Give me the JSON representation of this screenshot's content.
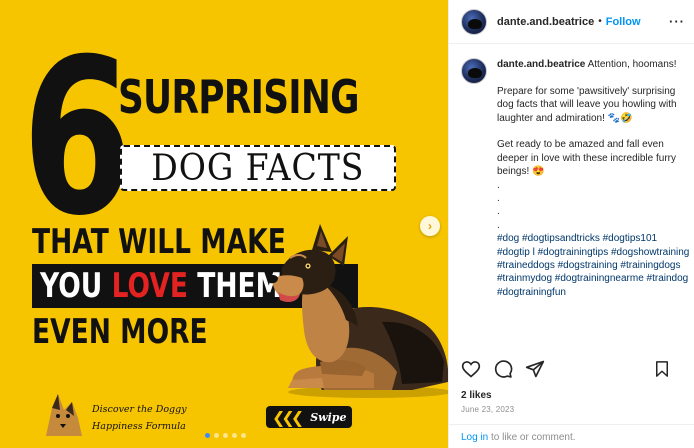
{
  "post_image": {
    "number": "6",
    "headline": "SURPRISING",
    "boxed_text": "DOG FACTS",
    "line1": "THAT WILL MAKE",
    "line2_before": "YOU ",
    "line2_highlight": "LOVE",
    "line2_after": " THEM",
    "line3": "EVEN MORE",
    "logo_line1": "Discover the Doggy",
    "logo_line2": "Happiness Formula",
    "swipe_arrows": "❮❮❮",
    "swipe_label": "Swipe",
    "next_icon": "›",
    "carousel_slides": 5,
    "carousel_active": 0,
    "colors": {
      "background": "#f7c500",
      "text": "#111111",
      "highlight": "#e32222"
    }
  },
  "header": {
    "username": "dante.and.beatrice",
    "separator": "•",
    "follow_label": "Follow",
    "more_label": "···"
  },
  "caption": {
    "username": "dante.and.beatrice",
    "first_line": "Attention, hoomans!",
    "para1": "Prepare for some 'pawsitively' surprising dog facts that will leave you howling with laughter and admiration! 🐾🤣",
    "para2": "Get ready to be amazed and fall even deeper in love with these incredible furry beings! 😍",
    "dots": [
      ".",
      ".",
      ".",
      "."
    ],
    "hashtags": "#dog #dogtipsandtricks #dogtips101 #dogtip l #dogtrainingtips #dogshowtraining #traineddogs #dogstraining #trainingdogs #trainmydog #dogtrainingnearme #traindog #dogtrainingfun"
  },
  "actions": {
    "icons": [
      "heart-icon",
      "comment-icon",
      "share-icon",
      "bookmark-icon"
    ]
  },
  "likes": "2 likes",
  "date": "June 23, 2023",
  "footer": {
    "login_link": "Log in",
    "rest": " to like or comment."
  }
}
